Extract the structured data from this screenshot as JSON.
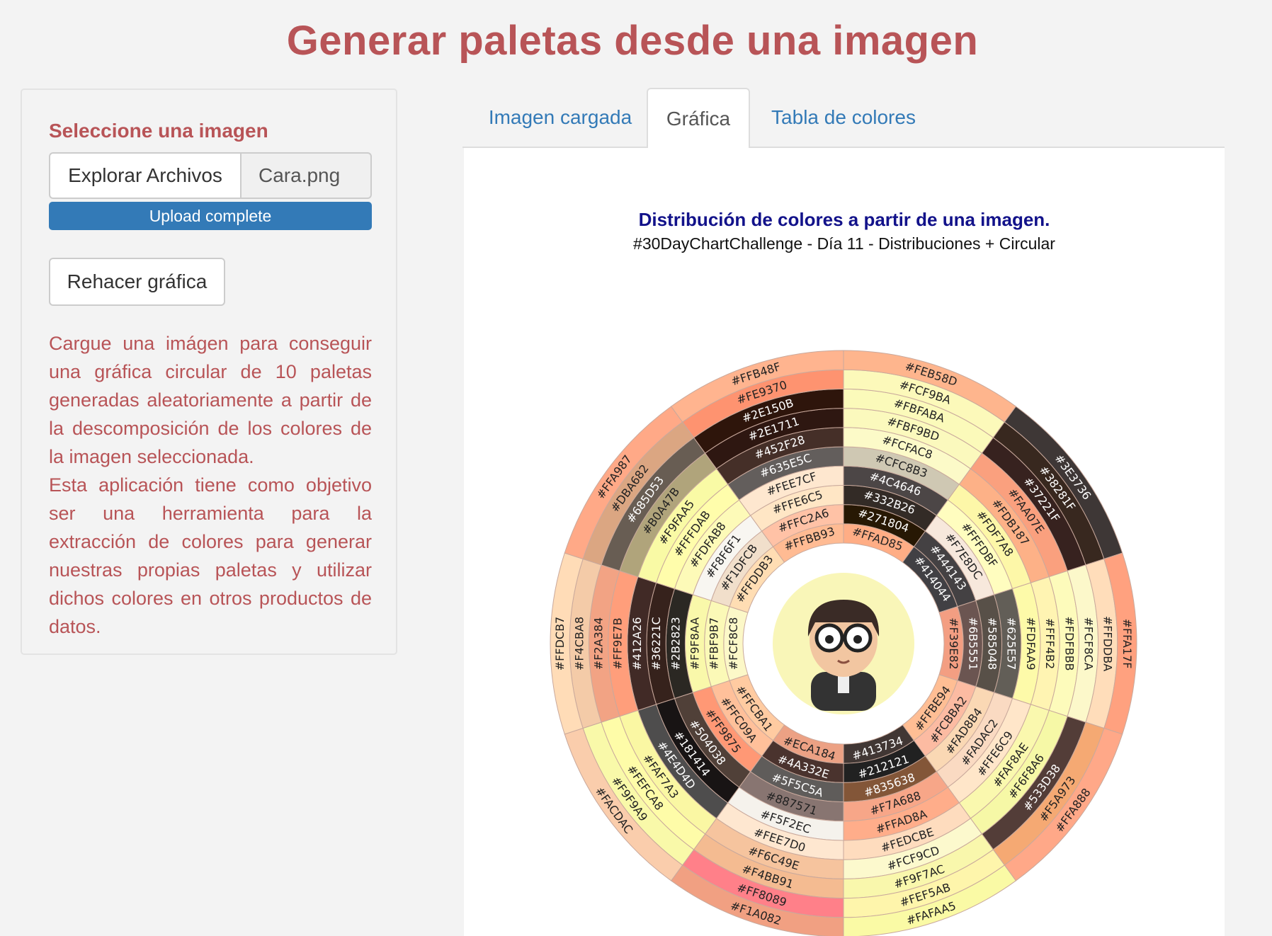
{
  "page": {
    "title": "Generar paletas desde una imagen"
  },
  "sidebar": {
    "heading": "Seleccione una imagen",
    "browse_label": "Explorar Archivos",
    "file_name": "Cara.png",
    "progress_label": "Upload complete",
    "progress_value": 1.0,
    "redo_label": "Rehacer gráfica",
    "description_1": "Cargue una imágen para conseguir una gráfica circular de 10 paletas generadas aleatoriamente a partir de la descomposición de los colores de la imagen seleccionada.",
    "description_2": "Esta aplicación tiene como objetivo ser una herramienta para la extracción de colores para generar nuestras propias paletas y utilizar dichos colores en otros productos de datos."
  },
  "tabs": [
    {
      "label": "Imagen cargada",
      "active": false
    },
    {
      "label": "Gráfica",
      "active": true
    },
    {
      "label": "Tabla de colores",
      "active": false
    }
  ],
  "colors": {
    "accent": "#b85457",
    "link": "#337ab7",
    "chart_title": "#12128a"
  },
  "chart_data": {
    "type": "pie",
    "title": "Distribución de colores a partir de una imagen.",
    "subtitle": "#30DayChartChallenge - Día 11 - Distribuciones + Circular",
    "rings": 6,
    "segments": [
      {
        "colors": [
          "#FFAD85",
          "#271804",
          "#332B26",
          "#4C4646",
          "#CFC8B3",
          "#FCFAC8",
          "#FBF9BD",
          "#FBFABA",
          "#FCF9BA",
          "#FEB58D"
        ]
      },
      {
        "colors": [
          "#414044",
          "#444143",
          "#F7E8DC",
          "#FFFDBF",
          "#FDF7A8",
          "#FDB187",
          "#FAA07E",
          "#37221F",
          "#38281F",
          "#3E3736"
        ]
      },
      {
        "colors": [
          "#F39E82",
          "#6B5551",
          "#585048",
          "#625E57",
          "#FDFAA9",
          "#FFF4B2",
          "#FDFBBB",
          "#FCF8CA",
          "#FFDDBA",
          "#FFA17F"
        ]
      },
      {
        "colors": [
          "#FFBE94",
          "#FCBBA2",
          "#FAD8B4",
          "#FADAC2",
          "#FFE6C9",
          "#FAF8AE",
          "#F6F8A6",
          "#533D38",
          "#F5A973",
          "#FFA888"
        ]
      },
      {
        "colors": [
          "#413734",
          "#212121",
          "#835638",
          "#F7A688",
          "#FFAD8A",
          "#FEDCBE",
          "#FCF9CD",
          "#F9F7AC",
          "#FEF5AB",
          "#FAFAA5"
        ]
      },
      {
        "colors": [
          "#ECA184",
          "#4A332E",
          "#5F5C5A",
          "#887571",
          "#F5F2EC",
          "#FEE7D0",
          "#F6C49E",
          "#F4BB91",
          "#FF8089",
          "#F1A082"
        ]
      },
      {
        "colors": [
          "#FFCBA1",
          "#FFC09A",
          "#FF9875",
          "#504038",
          "#181414",
          "#4E4D4D",
          "#FAF7A3",
          "#FEFCA8",
          "#F9F9A9",
          "#FACDAC"
        ]
      },
      {
        "colors": [
          "#FCF8C8",
          "#FBF9B7",
          "#F9F8AA",
          "#2B2823",
          "#36221C",
          "#412A26",
          "#FF9E7B",
          "#F2A384",
          "#F4CBA8",
          "#FFDCB7"
        ]
      },
      {
        "colors": [
          "#FFDDB3",
          "#F1DFCB",
          "#F8F6F1",
          "#FDFAB8",
          "#FFFDAB",
          "#F9FAA5",
          "#B0A47B",
          "#685D53",
          "#DBA682",
          "#FFA987"
        ]
      },
      {
        "colors": [
          "#FFBB93",
          "#FFC2A6",
          "#FFE6C5",
          "#FEE7CF",
          "#635E5C",
          "#452F28",
          "#2E1711",
          "#2E150B",
          "#FE9370",
          "#FFB48F"
        ]
      }
    ]
  }
}
